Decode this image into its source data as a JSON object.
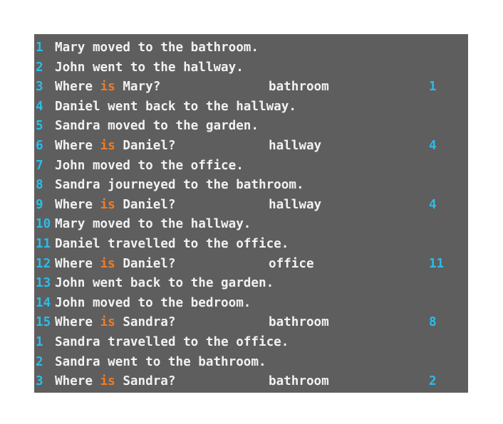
{
  "panel": {
    "name": "babi-story-transcript",
    "background_color": "#5e5e5e",
    "line_number_color": "#29bdec",
    "text_color": "#f2f2f2",
    "keyword_color": "#f07c24",
    "support_color": "#29bdec",
    "keyword": "is"
  },
  "lines": [
    {
      "num": "1",
      "type": "statement",
      "text": "Mary moved to the bathroom.",
      "pre": "",
      "kw": "",
      "post": "",
      "answer": "",
      "support": ""
    },
    {
      "num": "2",
      "type": "statement",
      "text": "John went to the hallway.",
      "pre": "",
      "kw": "",
      "post": "",
      "answer": "",
      "support": ""
    },
    {
      "num": "3",
      "type": "question",
      "text": "Where is Mary?",
      "pre": "Where ",
      "kw": "is",
      "post": " Mary?",
      "answer": "bathroom",
      "support": "1"
    },
    {
      "num": "4",
      "type": "statement",
      "text": "Daniel went back to the hallway.",
      "pre": "",
      "kw": "",
      "post": "",
      "answer": "",
      "support": ""
    },
    {
      "num": "5",
      "type": "statement",
      "text": "Sandra moved to the garden.",
      "pre": "",
      "kw": "",
      "post": "",
      "answer": "",
      "support": ""
    },
    {
      "num": "6",
      "type": "question",
      "text": "Where is Daniel?",
      "pre": "Where ",
      "kw": "is",
      "post": " Daniel?",
      "answer": "hallway",
      "support": "4"
    },
    {
      "num": "7",
      "type": "statement",
      "text": "John moved to the office.",
      "pre": "",
      "kw": "",
      "post": "",
      "answer": "",
      "support": ""
    },
    {
      "num": "8",
      "type": "statement",
      "text": "Sandra journeyed to the bathroom.",
      "pre": "",
      "kw": "",
      "post": "",
      "answer": "",
      "support": ""
    },
    {
      "num": "9",
      "type": "question",
      "text": "Where is Daniel?",
      "pre": "Where ",
      "kw": "is",
      "post": " Daniel?",
      "answer": "hallway",
      "support": "4"
    },
    {
      "num": "10",
      "type": "statement",
      "text": "Mary moved to the hallway.",
      "pre": "",
      "kw": "",
      "post": "",
      "answer": "",
      "support": ""
    },
    {
      "num": "11",
      "type": "statement",
      "text": "Daniel travelled to the office.",
      "pre": "",
      "kw": "",
      "post": "",
      "answer": "",
      "support": ""
    },
    {
      "num": "12",
      "type": "question",
      "text": "Where is Daniel?",
      "pre": "Where ",
      "kw": "is",
      "post": " Daniel?",
      "answer": "office",
      "support": "11"
    },
    {
      "num": "13",
      "type": "statement",
      "text": "John went back to the garden.",
      "pre": "",
      "kw": "",
      "post": "",
      "answer": "",
      "support": ""
    },
    {
      "num": "14",
      "type": "statement",
      "text": "John moved to the bedroom.",
      "pre": "",
      "kw": "",
      "post": "",
      "answer": "",
      "support": ""
    },
    {
      "num": "15",
      "type": "question",
      "text": "Where is Sandra?",
      "pre": "Where ",
      "kw": "is",
      "post": " Sandra?",
      "answer": "bathroom",
      "support": "8"
    },
    {
      "num": "1",
      "type": "statement",
      "text": "Sandra travelled to the office.",
      "pre": "",
      "kw": "",
      "post": "",
      "answer": "",
      "support": ""
    },
    {
      "num": "2",
      "type": "statement",
      "text": "Sandra went to the bathroom.",
      "pre": "",
      "kw": "",
      "post": "",
      "answer": "",
      "support": ""
    },
    {
      "num": "3",
      "type": "question",
      "text": "Where is Sandra?",
      "pre": "Where ",
      "kw": "is",
      "post": " Sandra?",
      "answer": "bathroom",
      "support": "2"
    }
  ]
}
